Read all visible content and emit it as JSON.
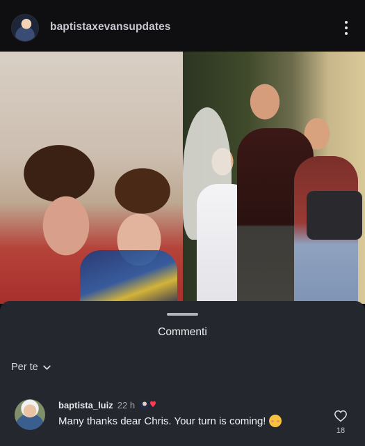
{
  "header": {
    "username": "baptistaxevansupdates"
  },
  "sheet": {
    "title": "Commenti",
    "sort_label": "Per te"
  },
  "comment": {
    "username": "baptista_luiz",
    "time": "22 h",
    "text": "Many thanks dear Chris. Your turn is coming!",
    "like_count": "18"
  },
  "colors": {
    "sheet_bg": "#25272e",
    "header_bg": "#0f0f12"
  }
}
